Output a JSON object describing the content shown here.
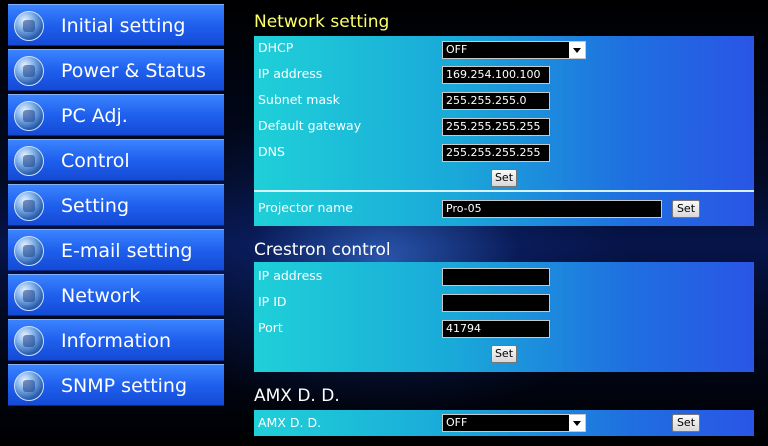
{
  "sidebar": {
    "items": [
      {
        "label": "Initial setting",
        "icon": "settings-icon"
      },
      {
        "label": "Power & Status",
        "icon": "power-icon"
      },
      {
        "label": "PC Adj.",
        "icon": "monitor-icon"
      },
      {
        "label": "Control",
        "icon": "control-icon"
      },
      {
        "label": "Setting",
        "icon": "wrench-icon"
      },
      {
        "label": "E-mail setting",
        "icon": "mail-icon"
      },
      {
        "label": "Network",
        "icon": "network-icon"
      },
      {
        "label": "Information",
        "icon": "info-icon"
      },
      {
        "label": "SNMP setting",
        "icon": "snmp-icon"
      }
    ]
  },
  "network": {
    "title": "Network setting",
    "dhcp_label": "DHCP",
    "dhcp_value": "OFF",
    "ip_label": "IP address",
    "ip_value": "169.254.100.100",
    "subnet_label": "Subnet mask",
    "subnet_value": "255.255.255.0",
    "gateway_label": "Default gateway",
    "gateway_value": "255.255.255.255",
    "dns_label": "DNS",
    "dns_value": "255.255.255.255",
    "set_label": "Set",
    "projector_label": "Projector name",
    "projector_value": "Pro-05",
    "projector_set_label": "Set"
  },
  "crestron": {
    "title": "Crestron control",
    "ip_label": "IP address",
    "ip_value": "",
    "ipid_label": "IP ID",
    "ipid_value": "",
    "port_label": "Port",
    "port_value": "41794",
    "set_label": "Set"
  },
  "amx": {
    "title": "AMX D. D.",
    "label": "AMX D. D.",
    "value": "OFF",
    "set_label": "Set"
  },
  "colors": {
    "network_title": "#ffff66",
    "nav_blue": "#1f60ee",
    "panel_cyan": "#1fd0d8"
  }
}
